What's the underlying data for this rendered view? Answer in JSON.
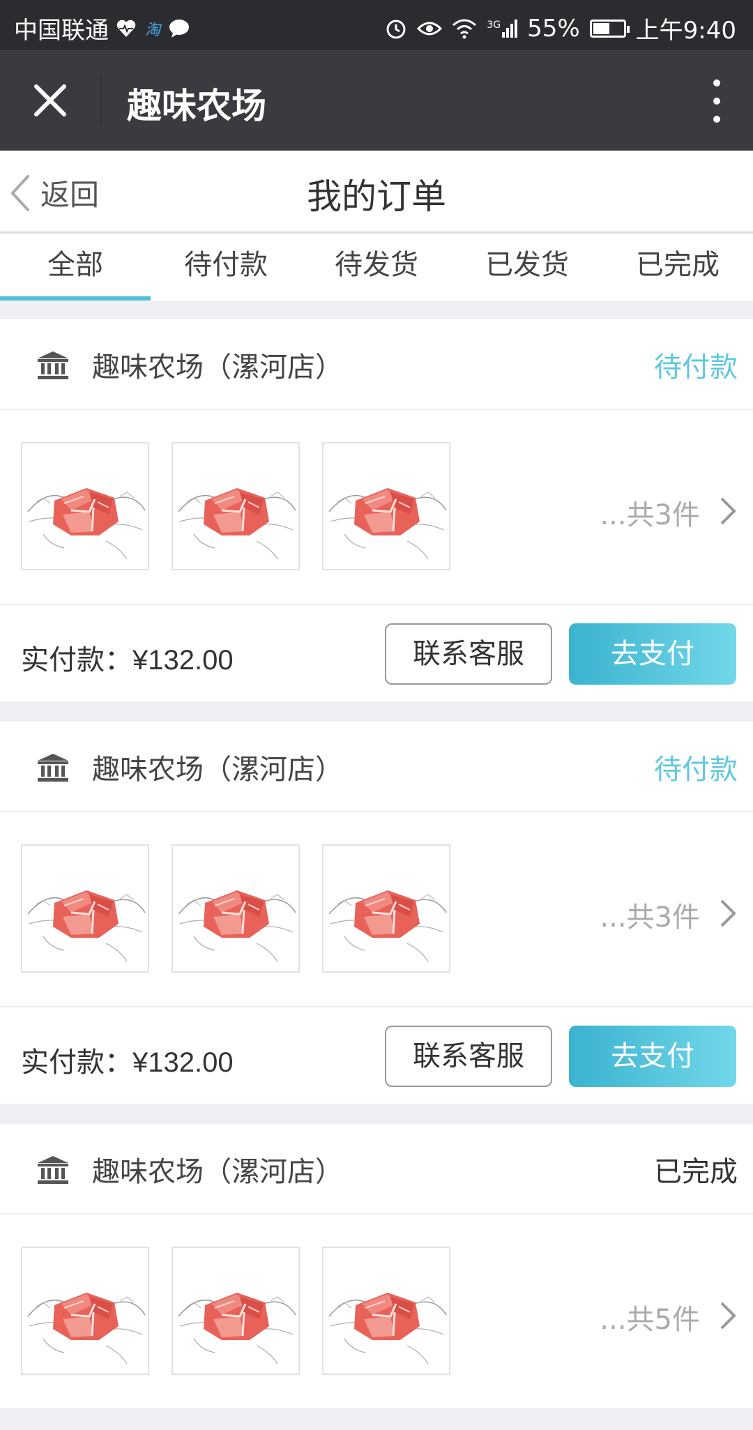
{
  "status_bar": {
    "carrier": "中国联通",
    "app_badge": "淘",
    "network": "3G",
    "battery": "55%",
    "battery_level": 0.55,
    "time": "上午9:40"
  },
  "app_bar": {
    "title": "趣味农场"
  },
  "page_header": {
    "back_label": "返回",
    "title": "我的订单"
  },
  "tabs": [
    {
      "label": "全部",
      "active": true
    },
    {
      "label": "待付款",
      "active": false
    },
    {
      "label": "待发货",
      "active": false
    },
    {
      "label": "已发货",
      "active": false
    },
    {
      "label": "已完成",
      "active": false
    }
  ],
  "colors": {
    "accent": "#50bfd6",
    "pending_status": "#5fc8e0",
    "completed_status": "#333333"
  },
  "orders": [
    {
      "shop_name": "趣味农场（漯河店）",
      "status": "待付款",
      "count_text": "...共3件",
      "pay_label": "实付款：",
      "amount": "¥132.00",
      "service_button": "联系客服",
      "pay_button": "去支付"
    },
    {
      "shop_name": "趣味农场（漯河店）",
      "status": "待付款",
      "count_text": "...共3件",
      "pay_label": "实付款：",
      "amount": "¥132.00",
      "service_button": "联系客服",
      "pay_button": "去支付"
    },
    {
      "shop_name": "趣味农场（漯河店）",
      "status": "已完成",
      "count_text": "...共5件"
    }
  ]
}
